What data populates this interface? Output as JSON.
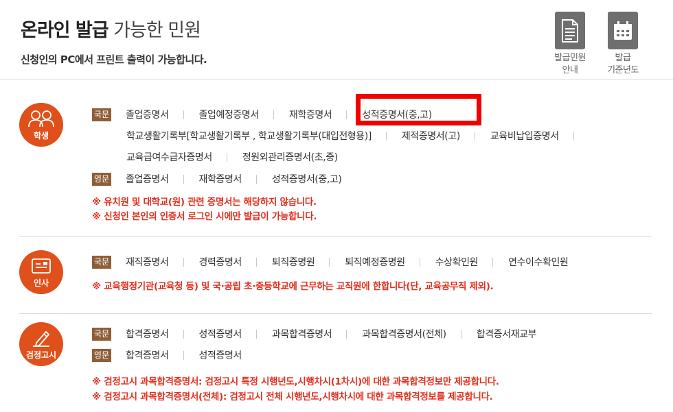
{
  "header": {
    "title_bold": "온라인 발급",
    "title_light": "가능한 민원",
    "subtitle": "신청인의 PC에서 프린트 출력이 가능합니다."
  },
  "quick_links": [
    {
      "label": "발급민원\n안내",
      "icon": "document-icon"
    },
    {
      "label": "발급\n기준년도",
      "icon": "calendar-icon"
    }
  ],
  "tags": {
    "korean": "국문",
    "english": "영문"
  },
  "sections": {
    "student": {
      "badge": "학생",
      "korean_items": [
        "졸업증명서",
        "졸업예정증명서",
        "재학증명서",
        "성적증명서(중,고)",
        "학교생활기록부[학교생활기록부 , 학교생활기록부(대입전형용)]",
        "제적증명서(고)",
        "교육비납입증명서",
        "교육급여수급자증명서",
        "정원외관리증명서(초,중)"
      ],
      "english_items": [
        "졸업증명서",
        "재학증명서",
        "성적증명서(중,고)"
      ],
      "notes": [
        "※ 유치원 및 대학교(원) 관련 증명서는 해당하지 않습니다.",
        "※ 신청인 본인의 인증서 로그인 시에만 발급이 가능합니다."
      ]
    },
    "personnel": {
      "badge": "인사",
      "korean_items": [
        "재직증명서",
        "경력증명서",
        "퇴직증명원",
        "퇴직예정증명원",
        "수상확인원",
        "연수이수확인원"
      ],
      "notes": [
        "※ 교육행정기관(교육청 등) 및 국·공립 초·중등학교에 근무하는 교직원에 한합니다(단, 교육공무직 제외)."
      ]
    },
    "exam": {
      "badge": "검정고시",
      "korean_items": [
        "합격증명서",
        "성적증명서",
        "과목합격증명서",
        "과목합격증명서(전체)",
        "합격증서재교부"
      ],
      "english_items": [
        "합격증명서",
        "성적증명서"
      ],
      "notes": [
        "※ 검정고시 과목합격증명서: 검정고시 특정 시행년도,시행차시(1차시)에 대한 과목합격정보만 제공합니다.",
        "※ 검정고시 과목합격증명서(전체): 검정고시 전체 시행년도,시행차시에 대한 과목합격정보를 제공합니다."
      ]
    }
  },
  "colors": {
    "accent": "#e0501b",
    "tag": "#8f5e38",
    "note": "#e0301e",
    "highlight": "#f20000",
    "quick_icon": "#6f6f6f"
  }
}
